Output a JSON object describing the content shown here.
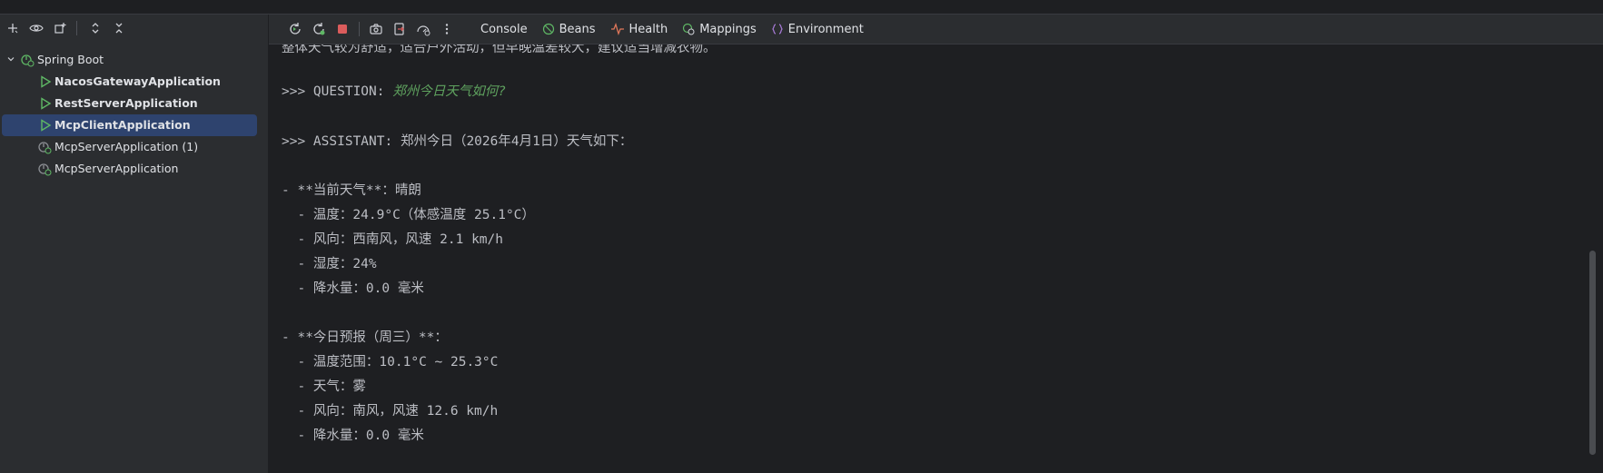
{
  "left_toolbar": {
    "icons": [
      "add-icon",
      "eye-icon",
      "new-group-icon",
      "expand-all-icon",
      "collapse-all-icon"
    ]
  },
  "tree": {
    "root": {
      "label": "Spring Boot"
    },
    "items": [
      {
        "label": "NacosGatewayApplication",
        "running": true
      },
      {
        "label": "RestServerApplication",
        "running": true
      },
      {
        "label": "McpClientApplication",
        "running": true,
        "selected": true
      },
      {
        "label": "McpServerApplication (1)",
        "running": false
      },
      {
        "label": "McpServerApplication",
        "running": false
      }
    ]
  },
  "right_toolbar": {
    "tabs": [
      {
        "label": "Console",
        "icon": "none"
      },
      {
        "label": "Beans",
        "icon": "beans-icon"
      },
      {
        "label": "Health",
        "icon": "health-icon"
      },
      {
        "label": "Mappings",
        "icon": "mappings-icon"
      },
      {
        "label": "Environment",
        "icon": "environment-icon"
      }
    ]
  },
  "console": {
    "partial_top_line": "整体天气较为舒适，适合户外活动，但早晚温差较大，建议适当增减衣物。",
    "question_prefix": ">>> QUESTION: ",
    "question_text": "郑州今日天气如何?",
    "assistant_line": ">>> ASSISTANT: 郑州今日（2026年4月1日）天气如下：",
    "current_header": "- **当前天气**：晴朗",
    "current_items": [
      "  - 温度：24.9°C（体感温度 25.1°C）",
      "  - 风向：西南风，风速 2.1 km/h",
      "  - 湿度：24%",
      "  - 降水量：0.0 毫米"
    ],
    "forecast_header": "- **今日预报（周三）**：",
    "forecast_items": [
      "  - 温度范围：10.1°C ~ 25.3°C",
      "  - 天气：雾",
      "  - 风向：南风，风速 12.6 km/h",
      "  - 降水量：0.0 毫米"
    ]
  },
  "colors": {
    "accent_selection": "#2e436e",
    "run_green": "#5fb865",
    "stop_red": "#db5c5c",
    "question_green": "#5fa35f"
  }
}
